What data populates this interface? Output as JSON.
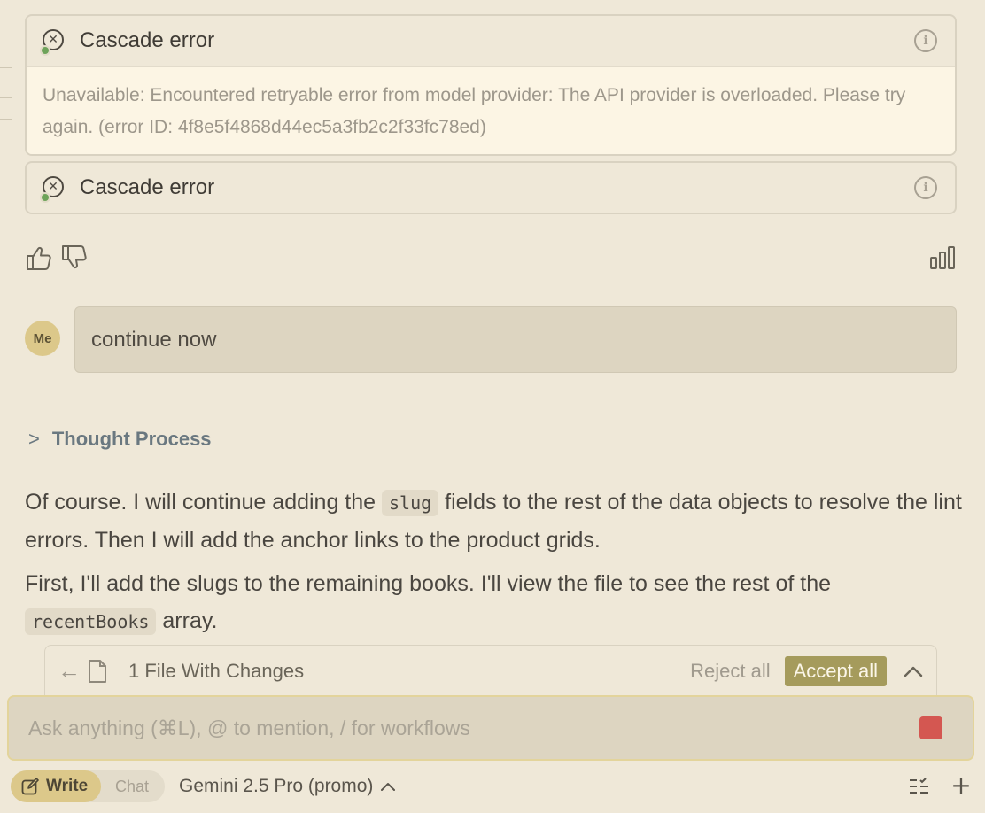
{
  "errors": [
    {
      "title": "Cascade error",
      "message": "Unavailable: Encountered retryable error from model provider: The API provider is overloaded. Please try again. (error ID: 4f8e5f4868d44ec5a3fb2c2f33fc78ed)",
      "expanded": true
    },
    {
      "title": "Cascade error",
      "expanded": false
    }
  ],
  "user_message": {
    "avatar_label": "Me",
    "text": "continue now"
  },
  "thought_process": {
    "label": "Thought Process",
    "expanded": false
  },
  "assistant": {
    "p1_before": "Of course. I will continue adding the ",
    "p1_code": "slug",
    "p1_after": " fields to the rest of the data objects to resolve the lint errors. Then I will add the anchor links to the product grids.",
    "p2_before": "First, I'll add the slugs to the remaining books. I'll view the file to see the rest of the ",
    "p2_code": "recentBooks",
    "p2_after": " array."
  },
  "changes_bar": {
    "label": "1 File With Changes",
    "reject_label": "Reject all",
    "accept_label": "Accept all"
  },
  "input": {
    "placeholder": "Ask anything (⌘L), @ to mention, / for workflows"
  },
  "bottom_bar": {
    "write_label": "Write",
    "chat_label": "Chat",
    "active_mode": "Write",
    "model_label": "Gemini 2.5 Pro (promo)"
  },
  "colors": {
    "background": "#efe8d8",
    "accent": "#a59b5c",
    "stop": "#d45751",
    "status_dot": "#6ea35a"
  }
}
